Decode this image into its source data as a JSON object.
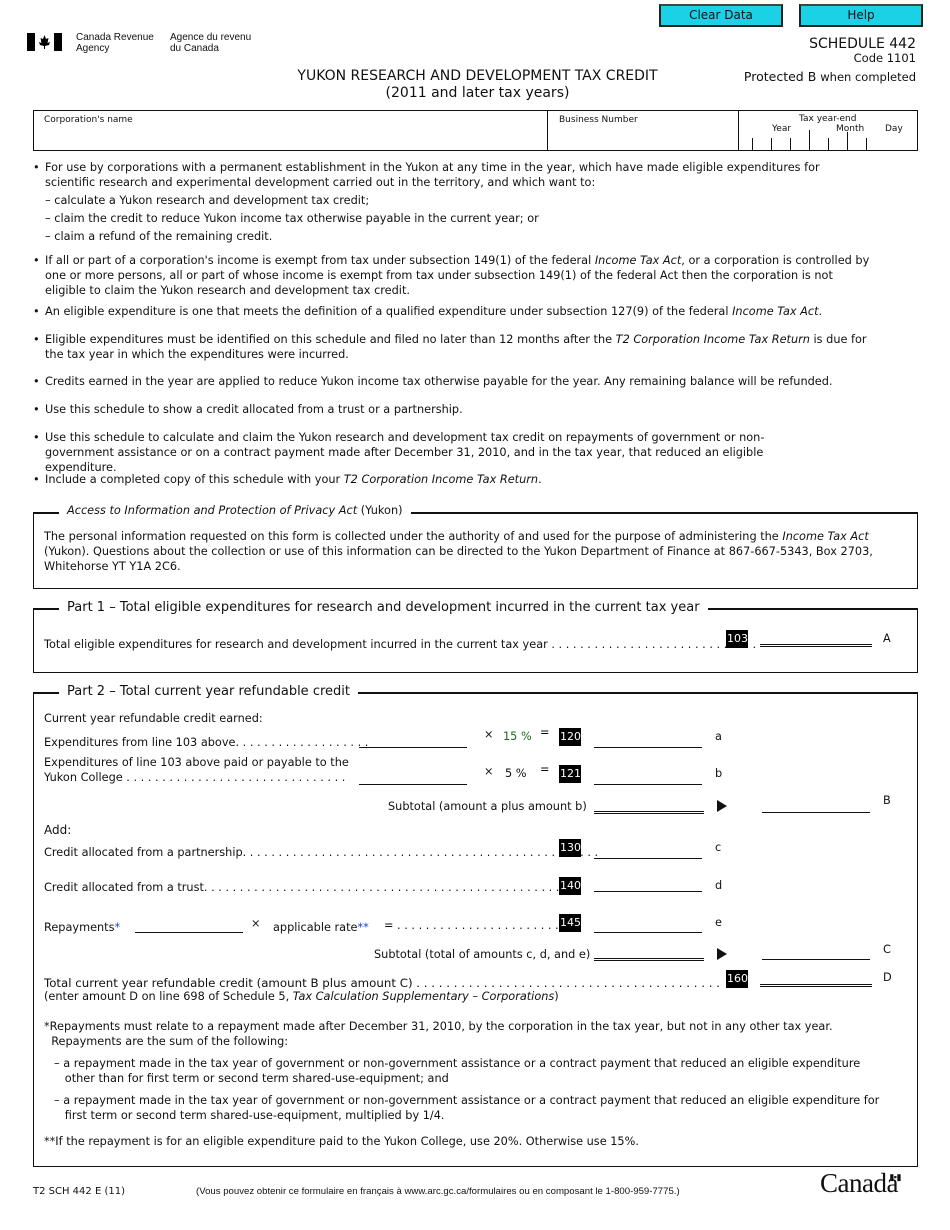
{
  "buttons": {
    "clear": "Clear Data",
    "help": "Help"
  },
  "header": {
    "agency_en": [
      "Canada Revenue",
      "Agency"
    ],
    "agency_fr": [
      "Agence du revenu",
      "du Canada"
    ],
    "schedule": "SCHEDULE 442",
    "code": "Code 1101",
    "protected": "Protected B",
    "protected_suffix": "when completed",
    "title": "YUKON RESEARCH AND DEVELOPMENT TAX CREDIT",
    "subtitle": "(2011 and later tax years)"
  },
  "idbox": {
    "corp_name": "Corporation's name",
    "business_number": "Business Number",
    "tax_year_end": "Tax year-end",
    "year": "Year",
    "month": "Month",
    "day": "Day"
  },
  "bullets": {
    "b1": "For use by corporations with a permanent establishment in the Yukon at any time in the year, which have made eligible expenditures for scientific research and experimental development carried out in the territory, and which want to:",
    "b1_subs": [
      "– calculate a Yukon research and development tax credit;",
      "– claim the credit to reduce Yukon income tax otherwise payable in the current year; or",
      "– claim a refund of the remaining credit."
    ],
    "b2a": "If all or part of a corporation's income is exempt from tax under subsection 149(1) of the federal ",
    "b2i": "Income Tax Act",
    "b2b": ", or a corporation is controlled by one or more persons, all or part of whose income is exempt from tax under subsection 149(1) of the federal Act then the corporation is not eligible to claim the Yukon research and development tax credit.",
    "b3a": "An eligible expenditure is one that meets the definition of a qualified expenditure under subsection 127(9) of the federal ",
    "b3i": "Income Tax Act",
    "b3b": ".",
    "b4a": "Eligible expenditures must be identified on this schedule and filed no later than 12 months after the ",
    "b4i": "T2 Corporation Income Tax Return",
    "b4b": " is due for the tax year in which the expenditures were incurred.",
    "b5": "Credits earned in the year are applied to reduce Yukon income tax otherwise payable for the year. Any remaining balance will be refunded.",
    "b6": "Use this schedule to show a credit allocated from a trust or a partnership.",
    "b7": "Use this schedule to calculate and claim the Yukon research and development tax credit on repayments of government or non-government assistance or on a contract payment made after December 31, 2010, and in the tax year, that reduced an eligible expenditure.",
    "b8a": "Include a completed copy of this schedule with your ",
    "b8i": "T2 Corporation Income Tax Return",
    "b8b": "."
  },
  "privacy": {
    "legend": "Access to Information and Protection of Privacy Act",
    "legend_suffix": " (Yukon)",
    "t1": "The personal information requested on this form is collected under the authority of and used for the purpose of administering the ",
    "t1i": "Income Tax Act",
    "t1b": " (Yukon). Questions about the collection or use of this information can be directed to the Yukon Department of Finance at 867-667-5343, Box 2703, Whitehorse YT  Y1A 2C6."
  },
  "part1": {
    "title": "Part 1 – Total eligible expenditures for research and development incurred in the current tax year",
    "line": "Total eligible expenditures for research and development incurred in the current tax year . . . . . . . . . . . . . . . . . . . . . . . . . . . . .",
    "code": "103",
    "letter": "A"
  },
  "part2": {
    "title": "Part 2 – Total current year refundable credit",
    "earned": "Current year refundable credit earned:",
    "exp1": "Expenditures from line 103 above. . . . . . . . . . . . . . . . . . .",
    "x": "×",
    "eq": "=",
    "rate1": "15 %",
    "code1": "120",
    "l1": "a",
    "exp2a": "Expenditures of line 103 above paid or payable to the",
    "exp2b": "Yukon College . . . . . . . . . . . . . . . . . . . . . . . . . . . . . . .",
    "rate2": "5 %",
    "code2": "121",
    "l2": "b",
    "subtotal1": "Subtotal (amount a plus amount b)",
    "lB": "B",
    "add": "Add:",
    "partnership": "Credit allocated from a partnership. . . . . . . . . . . . . . . . . . . . . . . . . . . . . . . . . . . . . . . . . . . . . . . . . .",
    "code3": "130",
    "l3": "c",
    "trust": "Credit allocated from a trust. . . . . . . . . . . . . . . . . . . . . . . . . . . . . . . . . . . . . . . . . . . . . . . . . . . . .",
    "code4": "140",
    "l4": "d",
    "repayments": "Repayments",
    "star": "*",
    "applicable": "applicable rate",
    "star2": "**",
    "dots5": "= . . . . . . . . . . . . . . . . . . . . . . .",
    "code5": "145",
    "l5": "e",
    "subtotal2": "Subtotal (total of amounts c, d, and e)",
    "lC": "C",
    "total": "Total current year refundable credit (amount B plus amount C) . . . . . . . . . . . . . . . . . . . . . . . . . . . . . . . . . . . . . . . . . . . . . . .",
    "code6": "160",
    "lD": "D",
    "enter_a": "(enter amount D on line 698 of Schedule 5, ",
    "enter_i": "Tax Calculation Supplementary – Corporations",
    "enter_b": ")",
    "n1": "Repayments must relate to a repayment made after December 31, 2010, by the corporation in the tax year, but not in any other tax year.",
    "n1b": "Repayments are the sum of the following:",
    "n2": "– a repayment made in the tax year of government or non-government assistance or a contract payment that reduced an eligible expenditure",
    "n2b": "other than for first term or second term shared-use-equipment; and",
    "n3": "– a repayment made in the tax year of government or non-government assistance or a contract payment that reduced an eligible expenditure for",
    "n3b": "first term or second term shared-use-equipment, multiplied by 1/4.",
    "n4": "If the repayment is for an eligible expenditure paid to the Yukon College, use 20%.  Otherwise use 15%."
  },
  "footer": {
    "form": "T2 SCH 442 E (11)",
    "french": "(Vous pouvez obtenir ce formulaire en français à www.arc.gc.ca/formulaires ou en composant le 1-800-959-7775.)",
    "wordmark": "Canada"
  },
  "colors": {
    "button": "#1ad1e6",
    "rate": "#1a6b1a",
    "asterisk": "#1a3fd1"
  }
}
